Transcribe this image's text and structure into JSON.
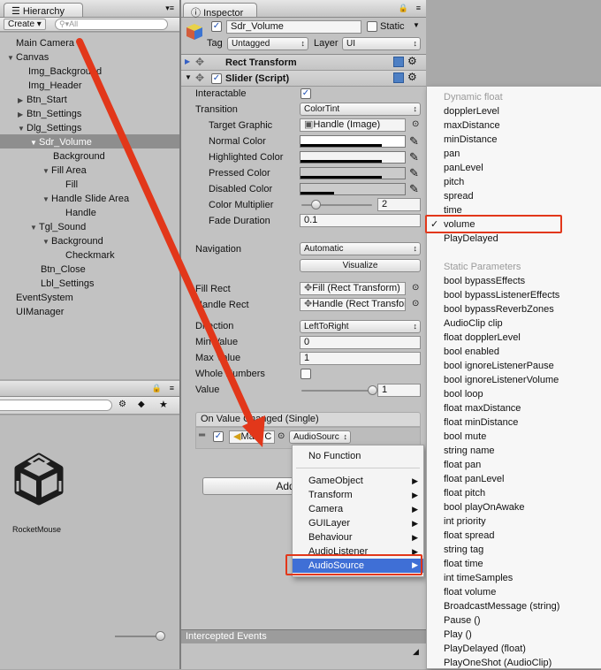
{
  "hierarchy": {
    "tab": "Hierarchy",
    "create": "Create",
    "search_placeholder": "All",
    "items": [
      "Main Camera",
      "Canvas",
      "Img_Background",
      "Img_Header",
      "Btn_Start",
      "Btn_Settings",
      "Dlg_Settings",
      "Sdr_Volume",
      "Background",
      "Fill Area",
      "Fill",
      "Handle Slide Area",
      "Handle",
      "Tgl_Sound",
      "Background",
      "Checkmark",
      "Btn_Close",
      "Lbl_Settings",
      "EventSystem",
      "UIManager"
    ],
    "selected_index": 7
  },
  "project": {
    "asset_label": "RocketMouse"
  },
  "inspector": {
    "tab": "Inspector",
    "name_value": "Sdr_Volume",
    "static_label": "Static",
    "tag_label": "Tag",
    "tag_value": "Untagged",
    "layer_label": "Layer",
    "layer_value": "UI",
    "rect_transform": "Rect Transform",
    "slider_title": "Slider (Script)",
    "interactable": "Interactable",
    "transition": "Transition",
    "transition_value": "ColorTint",
    "target_graphic": "Target Graphic",
    "target_graphic_value": "Handle (Image)",
    "normal_color": "Normal Color",
    "highlighted_color": "Highlighted Color",
    "pressed_color": "Pressed Color",
    "disabled_color": "Disabled Color",
    "color_multiplier": "Color Multiplier",
    "color_multiplier_value": "2",
    "color_multiplier_fraction": 0.2,
    "fade_duration": "Fade Duration",
    "fade_duration_value": "0.1",
    "navigation": "Navigation",
    "navigation_value": "Automatic",
    "visualize": "Visualize",
    "fill_rect": "Fill Rect",
    "fill_rect_value": "Fill (Rect Transform)",
    "handle_rect": "Handle Rect",
    "handle_rect_value": "Handle (Rect Transform)",
    "direction": "Direction",
    "direction_value": "LeftToRight",
    "min_value": "Min Value",
    "min_value_value": "0",
    "max_value": "Max Value",
    "max_value_value": "1",
    "whole_numbers": "Whole Numbers",
    "value": "Value",
    "value_value": "1",
    "value_fraction": 1.0,
    "on_value_changed": "On Value Changed (Single)",
    "event_object": "Main C",
    "event_function": "AudioSourc",
    "add_component": "Add C",
    "intercepted_events": "Intercepted Events"
  },
  "context_menu": {
    "no_function": "No Function",
    "items": [
      "GameObject",
      "Transform",
      "Camera",
      "GUILayer",
      "Behaviour",
      "AudioListener",
      "AudioSource"
    ],
    "selected": "AudioSource"
  },
  "submenu": {
    "dynamic_header": "Dynamic float",
    "dynamic": [
      "dopplerLevel",
      "maxDistance",
      "minDistance",
      "pan",
      "panLevel",
      "pitch",
      "spread",
      "time",
      "volume",
      "PlayDelayed"
    ],
    "checked": "volume",
    "static_header": "Static Parameters",
    "static": [
      "bool bypassEffects",
      "bool bypassListenerEffects",
      "bool bypassReverbZones",
      "AudioClip clip",
      "float dopplerLevel",
      "bool enabled",
      "bool ignoreListenerPause",
      "bool ignoreListenerVolume",
      "bool loop",
      "float maxDistance",
      "float minDistance",
      "bool mute",
      "string name",
      "float pan",
      "float panLevel",
      "float pitch",
      "bool playOnAwake",
      "int priority",
      "float spread",
      "string tag",
      "float time",
      "int timeSamples",
      "float volume",
      "BroadcastMessage (string)",
      "Pause ()",
      "Play ()",
      "PlayDelayed (float)",
      "PlayOneShot (AudioClip)"
    ]
  },
  "colors": {
    "annotation": "#e2371a",
    "selection": "#3f6fd6"
  }
}
